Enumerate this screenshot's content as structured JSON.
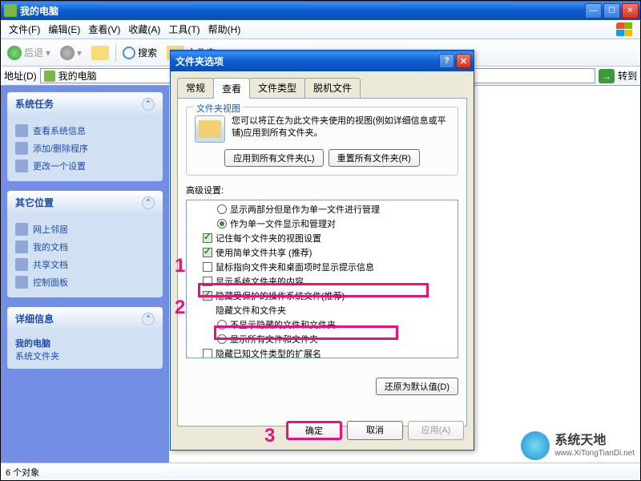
{
  "window": {
    "title": "我的电脑",
    "menu": {
      "file": "文件(F)",
      "edit": "编辑(E)",
      "view": "查看(V)",
      "favorites": "收藏(A)",
      "tools": "工具(T)",
      "help": "帮助(H)"
    },
    "toolbar": {
      "back": "后退",
      "search": "搜索",
      "folders": "文件夹"
    },
    "addressbar": {
      "label": "地址(D)",
      "value": "我的电脑",
      "go": "转到"
    },
    "statusbar": "6 个对象"
  },
  "sidebar": {
    "tasks": {
      "header": "系统任务",
      "items": [
        "查看系统信息",
        "添加/删除程序",
        "更改一个设置"
      ]
    },
    "places": {
      "header": "其它位置",
      "items": [
        "网上邻居",
        "我的文档",
        "共享文档",
        "控制面板"
      ]
    },
    "details": {
      "header": "详细信息",
      "line1": "我的电脑",
      "line2": "系统文件夹"
    }
  },
  "dialog": {
    "title": "文件夹选项",
    "tabs": [
      "常规",
      "查看",
      "文件类型",
      "脱机文件"
    ],
    "active_tab": 1,
    "folderview": {
      "group": "文件夹视图",
      "text": "您可以将正在为此文件夹使用的视图(例如详细信息或平铺)应用到所有文件夹。",
      "apply_all": "应用到所有文件夹(L)",
      "reset_all": "重置所有文件夹(R)"
    },
    "advanced": {
      "label": "高级设置:",
      "items": [
        {
          "type": "radio",
          "checked": false,
          "label": "显示两部分但是作为单一文件进行管理",
          "indent": 1
        },
        {
          "type": "radio",
          "checked": true,
          "label": "作为单一文件显示和管理对",
          "indent": 1
        },
        {
          "type": "check",
          "checked": true,
          "label": "记住每个文件夹的视图设置",
          "indent": 0
        },
        {
          "type": "check",
          "checked": true,
          "label": "使用简单文件共享 (推荐)",
          "indent": 0
        },
        {
          "type": "check",
          "checked": false,
          "label": "鼠标指向文件夹和桌面项时显示提示信息",
          "indent": 0
        },
        {
          "type": "check",
          "checked": false,
          "label": "显示系统文件夹的内容",
          "indent": 0
        },
        {
          "type": "check",
          "checked": true,
          "label": "隐藏受保护的操作系统文件(推荐)",
          "indent": 0
        },
        {
          "type": "none",
          "label": "隐藏文件和文件夹",
          "indent": 0
        },
        {
          "type": "radio",
          "checked": false,
          "label": "不显示隐藏的文件和文件夹",
          "indent": 1
        },
        {
          "type": "radio",
          "checked": false,
          "label": "显示所有文件和文件夹",
          "indent": 1
        },
        {
          "type": "check",
          "checked": false,
          "label": "隐藏已知文件类型的扩展名",
          "indent": 0
        }
      ]
    },
    "restore": "还原为默认值(D)",
    "buttons": {
      "ok": "确定",
      "cancel": "取消",
      "apply": "应用(A)"
    }
  },
  "annotations": {
    "one": "1",
    "two": "2",
    "three": "3"
  },
  "watermark": {
    "zh": "系统天地",
    "en": "www.XiTongTianDi.net"
  }
}
